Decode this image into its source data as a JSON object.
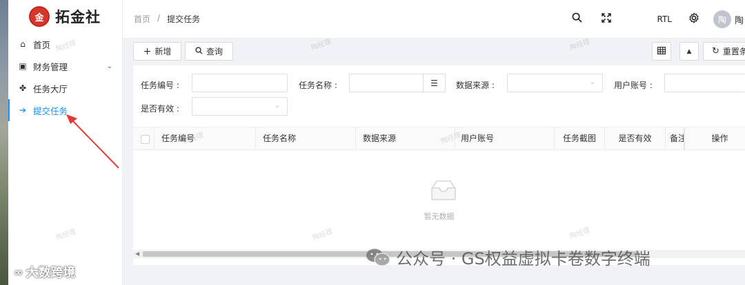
{
  "sidebar": {
    "logo_mark": "金",
    "logo_text": "拓金社",
    "items": [
      {
        "label": "首页",
        "icon": "home-icon",
        "glyph": "⌂"
      },
      {
        "label": "财务管理",
        "icon": "finance-icon",
        "glyph": "▣",
        "expandable": true
      },
      {
        "label": "任务大厅",
        "icon": "task-hall-icon",
        "glyph": "✤"
      },
      {
        "label": "提交任务",
        "icon": "arrow-right-icon",
        "glyph": "➔",
        "active": true
      }
    ]
  },
  "header": {
    "breadcrumb": [
      "首页",
      "/",
      "提交任务"
    ],
    "rtl_label": "RTL",
    "avatar_text": "陶",
    "username": "陶"
  },
  "toolbar": {
    "add_label": "新增",
    "query_label": "查询",
    "reset_label": "重置条"
  },
  "search_form": {
    "task_no_label": "任务编号 :",
    "task_name_label": "任务名称 :",
    "data_source_label": "数据来源 :",
    "user_account_label": "用户账号 :",
    "is_valid_label": "是否有效 :"
  },
  "table": {
    "columns": [
      "任务编号",
      "任务名称",
      "数据来源",
      "用户账号",
      "任务截图",
      "是否有效",
      "备注",
      "操作"
    ],
    "empty_text": "暂无数据"
  },
  "overlays": {
    "watermark_text": "陶经理",
    "footer_watermark": "公众号 · GS权益虚拟卡卷数字终端",
    "bottom_left_watermark": "大数跨境"
  },
  "colors": {
    "accent": "#1890ff",
    "logo_red": "#d9362b",
    "annotation_red": "#e53935"
  }
}
